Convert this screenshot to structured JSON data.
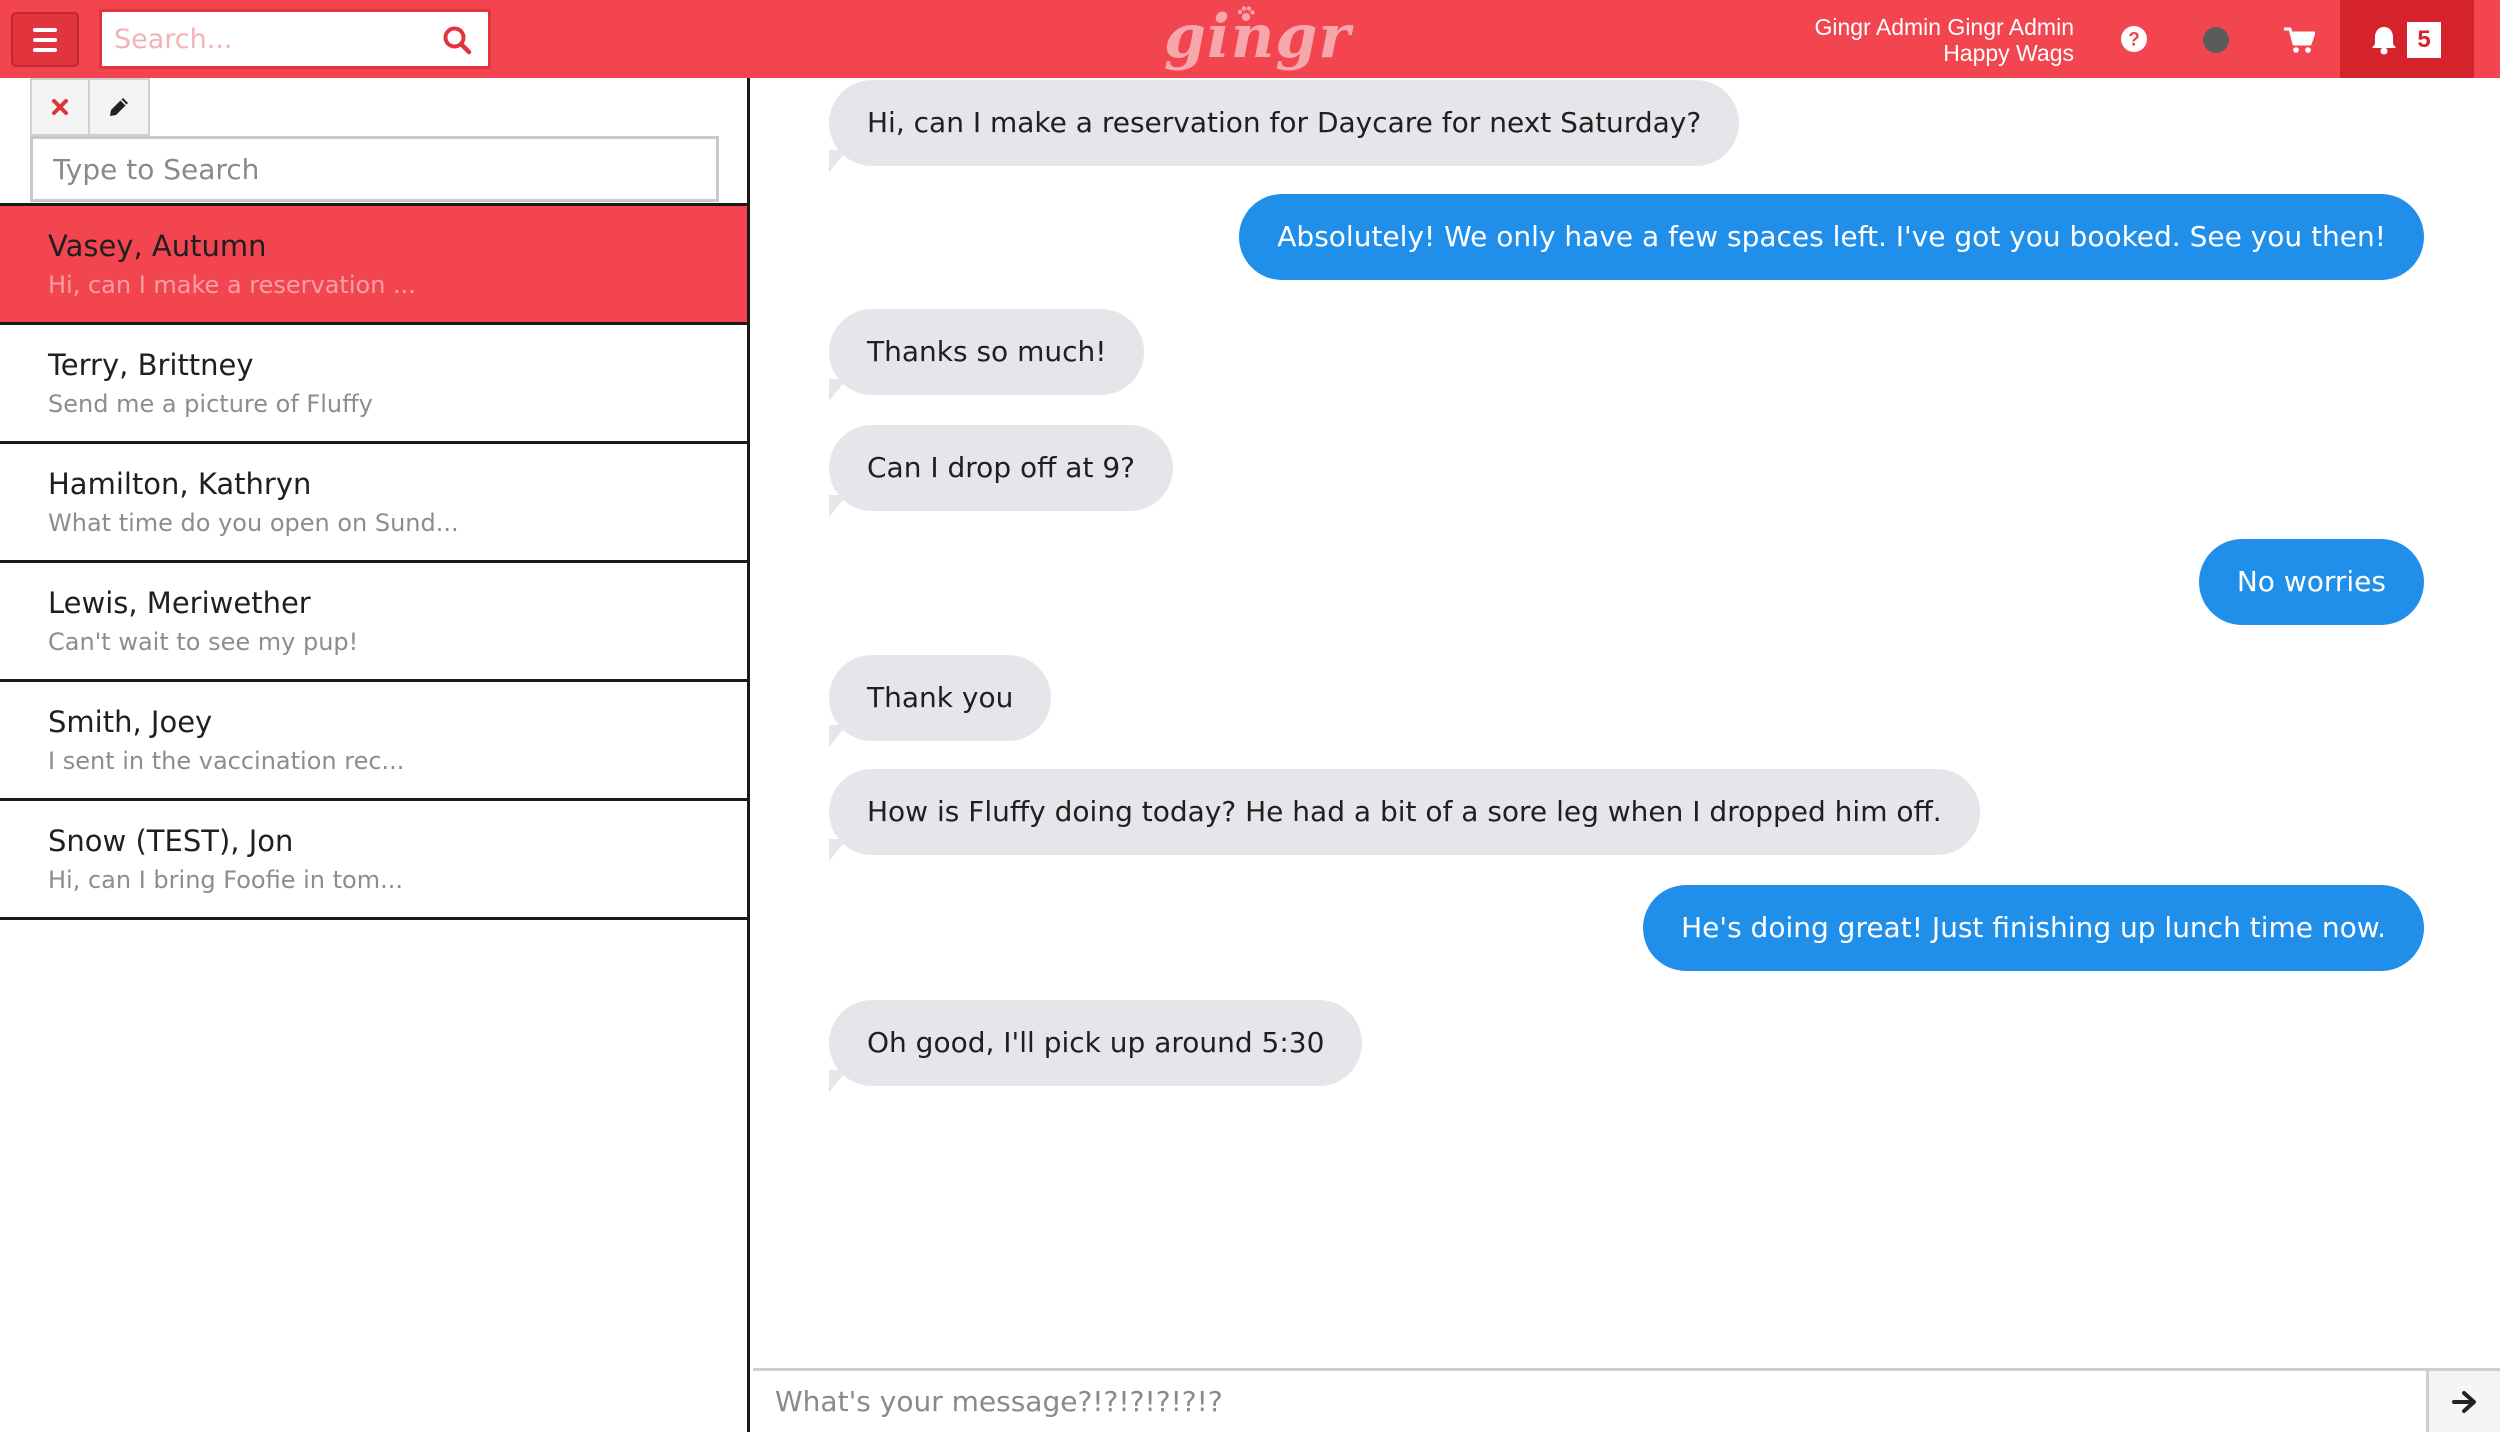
{
  "header": {
    "search_placeholder": "Search...",
    "logo_text": "gingr",
    "user_name": "Gingr Admin Gingr Admin",
    "location": "Happy Wags",
    "notification_count": "5",
    "brand_color": "#f3454f"
  },
  "sidebar": {
    "search_placeholder": "Type to Search",
    "conversations": [
      {
        "name": "Vasey, Autumn",
        "preview": "Hi, can I make a reservation ...",
        "active": true
      },
      {
        "name": "Terry, Brittney",
        "preview": "Send me a picture of Fluffy",
        "active": false
      },
      {
        "name": "Hamilton, Kathryn",
        "preview": "What time do you open on Sund...",
        "active": false
      },
      {
        "name": "Lewis, Meriwether",
        "preview": "Can't wait to see my pup!",
        "active": false
      },
      {
        "name": "Smith, Joey",
        "preview": "I sent in the vaccination rec...",
        "active": false
      },
      {
        "name": "Snow (TEST), Jon",
        "preview": "Hi, can I bring Foofie in tom...",
        "active": false
      }
    ]
  },
  "chat": {
    "messages": [
      {
        "direction": "in",
        "text": "Hi, can I make a reservation for Daycare for next Saturday?"
      },
      {
        "direction": "out",
        "text": "Absolutely! We only have a few spaces left. I've got you booked. See you then!"
      },
      {
        "direction": "in",
        "text": "Thanks so much!"
      },
      {
        "direction": "in",
        "text": "Can I drop off at 9?"
      },
      {
        "direction": "out",
        "text": "No worries"
      },
      {
        "direction": "in",
        "text": "Thank you"
      },
      {
        "direction": "in",
        "text": "How is Fluffy doing today? He had a bit of a sore leg when I dropped him off."
      },
      {
        "direction": "out",
        "text": "He's doing great! Just finishing up lunch time now."
      },
      {
        "direction": "in",
        "text": "Oh good, I'll pick up around 5:30"
      }
    ],
    "composer_placeholder": "What's your message?!?!?!?!?!?",
    "incoming_color": "#e5e5ea",
    "outgoing_color": "#1f8fea"
  }
}
